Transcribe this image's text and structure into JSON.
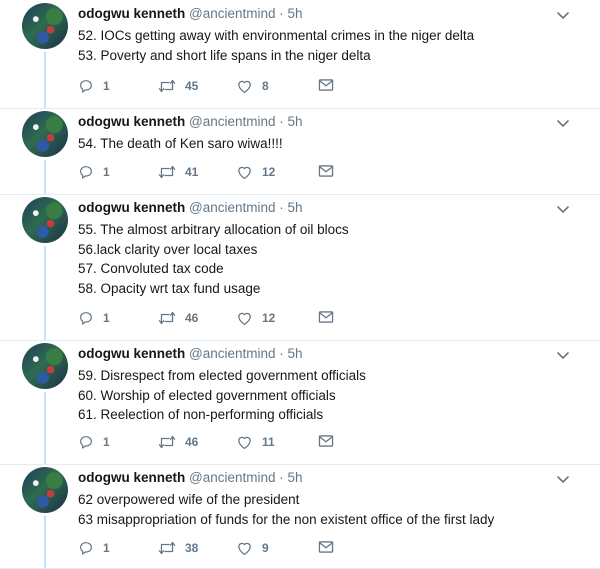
{
  "colors": {
    "text": "#14171a",
    "secondary": "#657786",
    "thread_line": "#bfe3ff",
    "divider": "#e6ecf0"
  },
  "icons": {
    "reply": "reply-icon",
    "retweet": "retweet-icon",
    "like": "like-icon",
    "message": "direct-message-icon",
    "menu": "chevron-down-icon"
  },
  "tweets": [
    {
      "name": "odogwu kenneth",
      "handle": "@ancientmind",
      "dot": "·",
      "time": "5h",
      "lines": [
        "52. IOCs getting away with environmental crimes in the niger delta",
        "53. Poverty and short life spans in the niger delta"
      ],
      "replies": "1",
      "retweets": "45",
      "likes": "8"
    },
    {
      "name": "odogwu kenneth",
      "handle": "@ancientmind",
      "dot": "·",
      "time": "5h",
      "lines": [
        "54. The death of Ken saro wiwa!!!!"
      ],
      "replies": "1",
      "retweets": "41",
      "likes": "12"
    },
    {
      "name": "odogwu kenneth",
      "handle": "@ancientmind",
      "dot": "·",
      "time": "5h",
      "lines": [
        "55. The almost arbitrary allocation of oil blocs",
        "56.lack clarity over local taxes",
        "57. Convoluted tax code",
        "58. Opacity wrt tax fund usage"
      ],
      "replies": "1",
      "retweets": "46",
      "likes": "12"
    },
    {
      "name": "odogwu kenneth",
      "handle": "@ancientmind",
      "dot": "·",
      "time": "5h",
      "lines": [
        "59. Disrespect from elected government officials",
        "60. Worship of elected government officials",
        "61. Reelection of non-performing officials"
      ],
      "replies": "1",
      "retweets": "46",
      "likes": "11"
    },
    {
      "name": "odogwu kenneth",
      "handle": "@ancientmind",
      "dot": "·",
      "time": "5h",
      "lines": [
        "62 overpowered wife of the president",
        "63 misappropriation of funds for the non existent office of the first lady"
      ],
      "replies": "1",
      "retweets": "38",
      "likes": "9"
    }
  ]
}
